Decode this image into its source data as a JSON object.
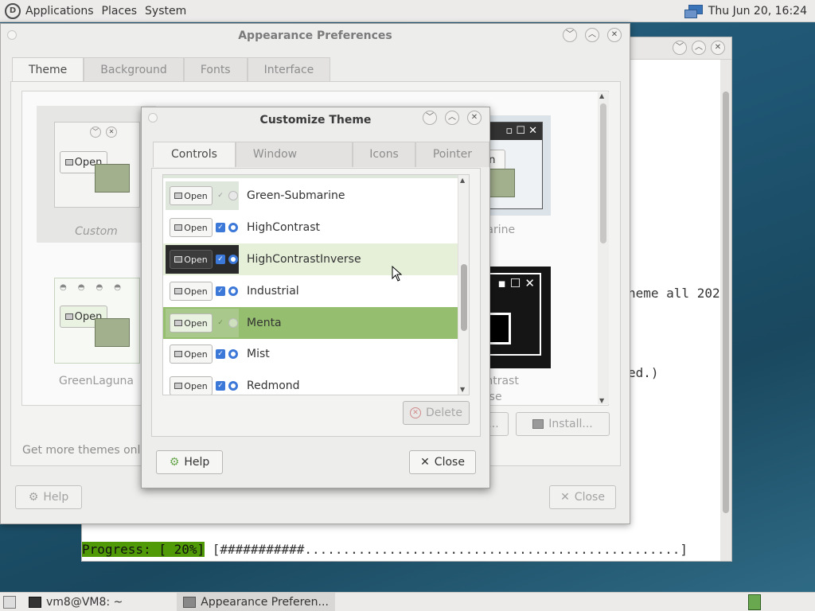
{
  "top_panel": {
    "menus": [
      "Applications",
      "Places",
      "System"
    ],
    "clock": "Thu Jun 20, 16:24"
  },
  "terminal": {
    "lines": [
      "heme all 202",
      "ed.)"
    ],
    "progress_label": "Progress: [ 20%]",
    "progress_bar": " [###########.................................................]",
    "progress_percent": 20
  },
  "appearance": {
    "title": "Appearance Preferences",
    "tabs": [
      "Theme",
      "Background",
      "Fonts",
      "Interface"
    ],
    "themes": [
      {
        "name": "Custom",
        "preview_open": "Open"
      },
      {
        "name": "Green-Submarine",
        "visible_caption": "ubmarine",
        "preview_open": "pen"
      },
      {
        "name": "GreenLaguna",
        "preview_open": "Open"
      },
      {
        "name": "HighContrastInverse",
        "visible_caption_1": "Contrast",
        "visible_caption_2": "verse"
      }
    ],
    "get_more_text": "Get more themes onlin",
    "install_label": "Install...",
    "save_as_label": "...",
    "help_label": "Help",
    "close_label": "Close"
  },
  "customize": {
    "title": "Customize Theme",
    "tabs": [
      "Controls",
      "Window Border",
      "Icons",
      "Pointer"
    ],
    "preview_open": "Open",
    "items": [
      {
        "name": "Green-Submarine",
        "style": "greensub"
      },
      {
        "name": "HighContrast",
        "style": "normal"
      },
      {
        "name": "HighContrastInverse",
        "style": "dark"
      },
      {
        "name": "Industrial",
        "style": "normal"
      },
      {
        "name": "Menta",
        "style": "menta"
      },
      {
        "name": "Mist",
        "style": "normal"
      },
      {
        "name": "Redmond",
        "style": "normal"
      }
    ],
    "selected": "Menta",
    "hovered": "HighContrastInverse",
    "delete_label": "Delete",
    "help_label": "Help",
    "close_label": "Close"
  },
  "taskbar": {
    "tasks": [
      "vm8@VM8: ~",
      "Appearance Preferen..."
    ]
  }
}
